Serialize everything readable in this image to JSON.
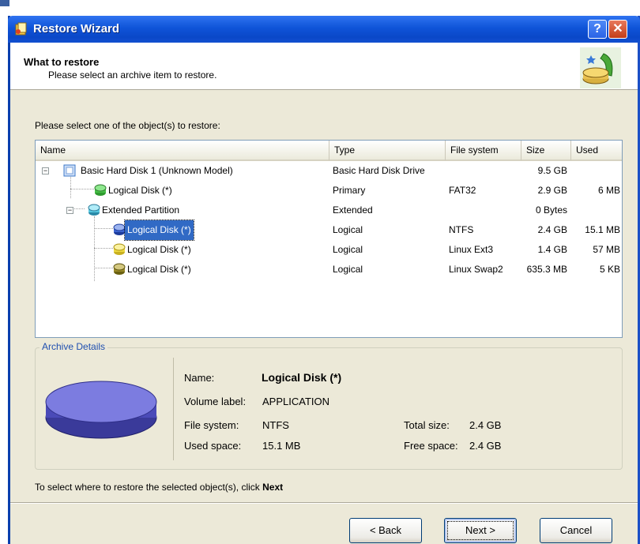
{
  "window": {
    "title": "Restore Wizard",
    "help_glyph": "?",
    "close_glyph": "✕"
  },
  "header": {
    "title": "What to restore",
    "subtitle": "Please select an archive item to restore."
  },
  "instruction": "Please select one of the object(s) to restore:",
  "tree": {
    "columns": [
      "Name",
      "Type",
      "File system",
      "Size",
      "Used"
    ],
    "rows": [
      {
        "name": "Basic Hard Disk 1 (Unknown Model)",
        "type": "Basic Hard Disk Drive",
        "fs": "",
        "size": "9.5 GB",
        "used": "",
        "icon": "hard-disk-icon",
        "expander": "−"
      },
      {
        "name": "Logical Disk (*)",
        "type": "Primary",
        "fs": "FAT32",
        "size": "2.9 GB",
        "used": "6 MB",
        "icon": "green-partition-icon"
      },
      {
        "name": "Extended Partition",
        "type": "Extended",
        "fs": "",
        "size": "0 Bytes",
        "used": "",
        "icon": "extended-partition-icon",
        "expander": "−"
      },
      {
        "name": "Logical Disk (*)",
        "type": "Logical",
        "fs": "NTFS",
        "size": "2.4 GB",
        "used": "15.1 MB",
        "icon": "blue-partition-icon"
      },
      {
        "name": "Logical Disk (*)",
        "type": "Logical",
        "fs": "Linux Ext3",
        "size": "1.4 GB",
        "used": "57 MB",
        "icon": "yellow-partition-icon"
      },
      {
        "name": "Logical Disk (*)",
        "type": "Logical",
        "fs": "Linux Swap2",
        "size": "635.3 MB",
        "used": "5 KB",
        "icon": "olive-partition-icon"
      }
    ]
  },
  "details": {
    "legend": "Archive Details",
    "name_label": "Name:",
    "name_value": "Logical Disk (*)",
    "volume_label": "Volume label:",
    "volume_value": "APPLICATION",
    "fs_label": "File system:",
    "fs_value": "NTFS",
    "used_label": "Used space:",
    "used_value": "15.1 MB",
    "total_label": "Total size:",
    "total_value": "2.4 GB",
    "free_label": "Free space:",
    "free_value": "2.4 GB"
  },
  "footer": {
    "text_before": "To select where to restore the selected object(s), click ",
    "text_bold": "Next"
  },
  "buttons": {
    "back": "< Back",
    "next": "Next >",
    "cancel": "Cancel"
  },
  "colors": {
    "selection": "#316ac5",
    "title_bar": "#0a47c8",
    "dialog_bg": "#ece9d8"
  }
}
